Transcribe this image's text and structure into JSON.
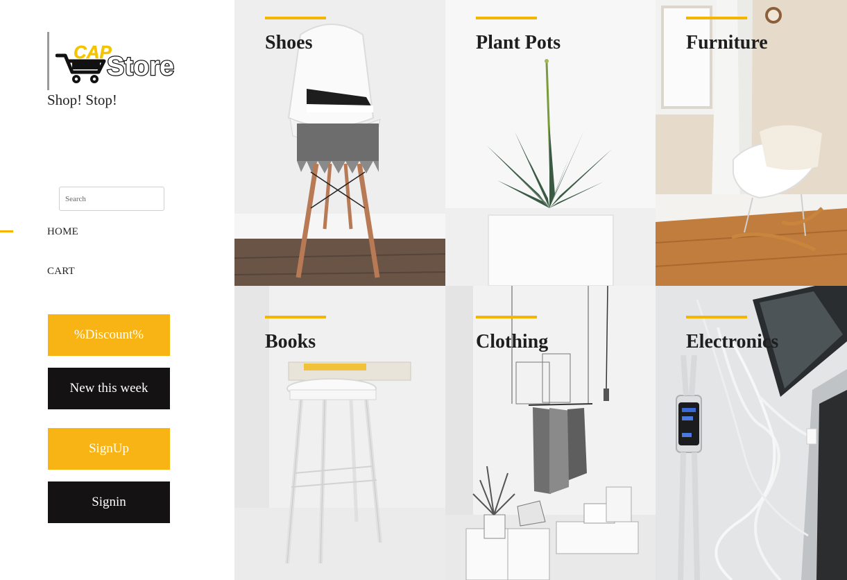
{
  "brand": {
    "logo_text_top": "CAP",
    "logo_text_main": "Store",
    "tagline": "Shop! Stop!"
  },
  "search": {
    "placeholder": "Search",
    "value": ""
  },
  "nav": {
    "items": [
      {
        "label": "HOME",
        "active": true
      },
      {
        "label": "CART",
        "active": false
      }
    ]
  },
  "buttons": {
    "discount": "%Discount%",
    "new_this_week": "New this week",
    "signup": "SignUp",
    "signin": "Signin"
  },
  "categories": [
    {
      "label": "Shoes",
      "icon": "chair-with-sneakers-photo"
    },
    {
      "label": "Plant Pots",
      "icon": "succulent-pot-photo"
    },
    {
      "label": "Furniture",
      "icon": "rocking-chair-photo"
    },
    {
      "label": "Books",
      "icon": "stool-with-book-photo"
    },
    {
      "label": "Clothing",
      "icon": "clothes-rack-photo"
    },
    {
      "label": "Electronics",
      "icon": "smartwatch-phone-photo"
    }
  ],
  "colors": {
    "accent": "#f5b400",
    "button_yellow": "#f7b414",
    "button_black": "#141213",
    "text": "#1e1e1e"
  }
}
